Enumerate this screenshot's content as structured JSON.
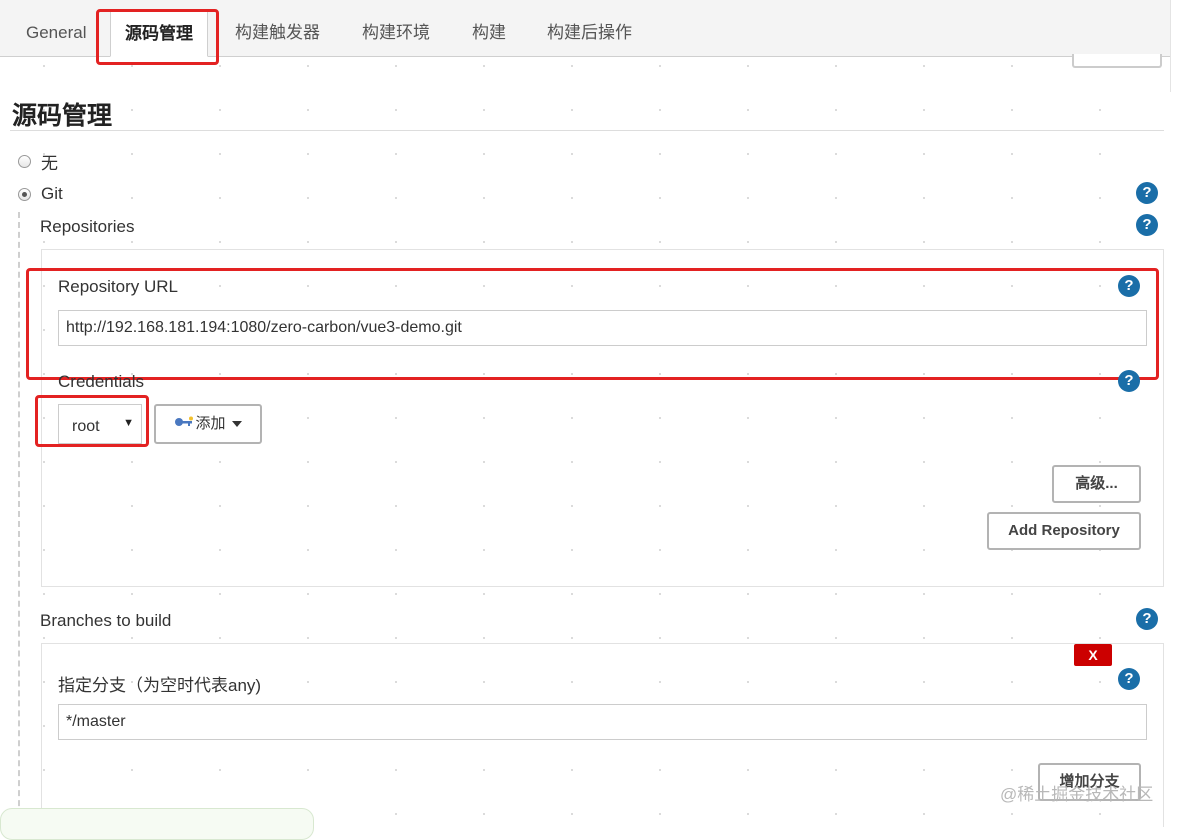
{
  "tabs": [
    {
      "label": "General"
    },
    {
      "label": "源码管理"
    },
    {
      "label": "构建触发器"
    },
    {
      "label": "构建环境"
    },
    {
      "label": "构建"
    },
    {
      "label": "构建后操作"
    }
  ],
  "section": {
    "title": "源码管理"
  },
  "scm_options": [
    {
      "label": "无",
      "selected": false
    },
    {
      "label": "Git",
      "selected": true
    }
  ],
  "git": {
    "repositories_label": "Repositories",
    "repository_url_label": "Repository URL",
    "repository_url_value": "http://192.168.181.194:1080/zero-carbon/vue3-demo.git",
    "credentials_label": "Credentials",
    "credentials_selected": "root",
    "add_credentials_label": "添加",
    "advanced_label": "高级...",
    "add_repository_label": "Add Repository"
  },
  "branches": {
    "label": "Branches to build",
    "delete_label": "X",
    "branch_specifier_label": "指定分支（为空时代表any)",
    "branch_specifier_value": "*/master",
    "add_branch_label": "增加分支"
  },
  "help_icon_text": "?",
  "watermark": "@稀土掘金技术社区",
  "colors": {
    "help_blue": "#1a6ea8",
    "highlight_red": "#e32222",
    "delete_red": "#cc0000"
  }
}
